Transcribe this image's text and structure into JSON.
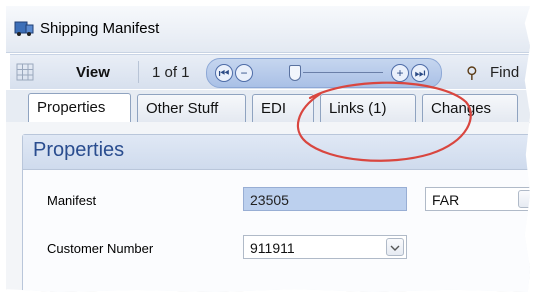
{
  "window": {
    "title": "Shipping Manifest"
  },
  "toolbar": {
    "view_label": "View",
    "page_indicator": "1 of 1",
    "find_label": "Find"
  },
  "tabs": [
    {
      "label": "Properties",
      "active": true
    },
    {
      "label": "Other Stuff",
      "active": false
    },
    {
      "label": "EDI",
      "active": false
    },
    {
      "label": "Links (1)",
      "active": false
    },
    {
      "label": "Changes",
      "active": false
    }
  ],
  "properties": {
    "heading": "Properties",
    "manifest": {
      "label": "Manifest",
      "value": "23505",
      "location": "FAR"
    },
    "customer_number": {
      "label": "Customer Number",
      "value": "911911"
    }
  },
  "annotation": {
    "shape": "ellipse",
    "color": "#d9463f"
  },
  "colors": {
    "accent": "#2a4d8f",
    "selected_field": "#bcd0ee",
    "toolbar_nav": "#a9c0e6"
  },
  "icons": {
    "app": "shipping-manifest-icon",
    "grid": "grid-icon",
    "first": "first-page-icon",
    "zoom_out": "zoom-out-icon",
    "zoom_in": "zoom-in-icon",
    "last": "last-page-icon",
    "find": "binoculars-icon"
  }
}
